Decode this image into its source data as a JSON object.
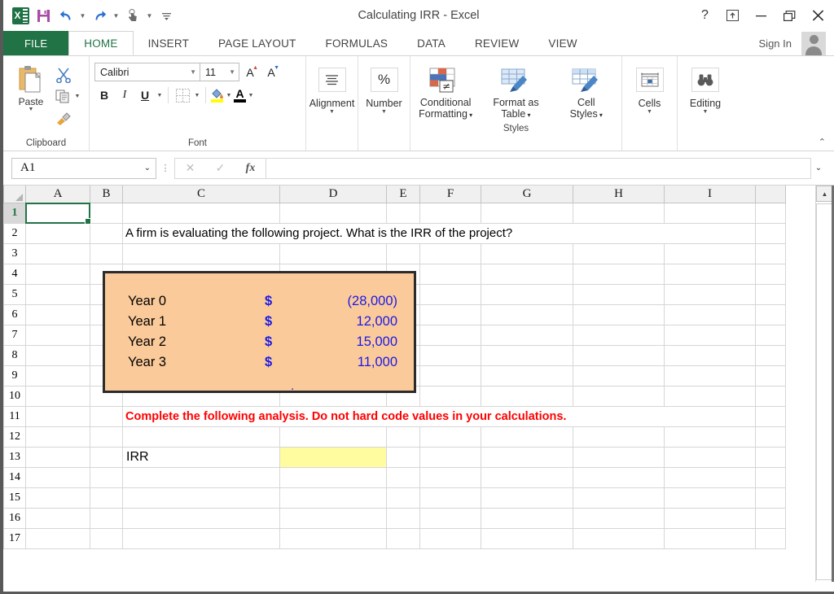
{
  "window": {
    "title": "Calculating IRR - Excel",
    "controls": {
      "help": "?",
      "ribbon_display": "ribbon-display-options",
      "minimize": "minimize",
      "restore": "restore",
      "close": "close"
    }
  },
  "quick_access": {
    "items": [
      {
        "name": "excel-logo",
        "label": "X"
      },
      {
        "name": "save-icon",
        "label": "Save"
      },
      {
        "name": "undo-icon",
        "label": "Undo"
      },
      {
        "name": "redo-icon",
        "label": "Redo"
      },
      {
        "name": "touch-mode-icon",
        "label": "Touch/Mouse Mode"
      },
      {
        "name": "customize-qat-icon",
        "label": "Customize Quick Access Toolbar"
      }
    ]
  },
  "tabs": [
    {
      "label": "FILE",
      "active": false
    },
    {
      "label": "HOME",
      "active": true
    },
    {
      "label": "INSERT",
      "active": false
    },
    {
      "label": "PAGE LAYOUT",
      "active": false
    },
    {
      "label": "FORMULAS",
      "active": false
    },
    {
      "label": "DATA",
      "active": false
    },
    {
      "label": "REVIEW",
      "active": false
    },
    {
      "label": "VIEW",
      "active": false
    }
  ],
  "account": {
    "sign_in": "Sign In"
  },
  "ribbon": {
    "groups": {
      "clipboard": {
        "label": "Clipboard",
        "paste": "Paste",
        "cut": "Cut",
        "copy": "Copy",
        "format_painter": "Format Painter"
      },
      "font": {
        "label": "Font",
        "font_name": "Calibri",
        "font_size": "11",
        "grow_font": "A",
        "shrink_font": "A",
        "bold": "B",
        "italic": "I",
        "underline": "U",
        "borders": "Borders",
        "fill_color": "Fill Color",
        "font_color": "A"
      },
      "alignment": {
        "label": "Alignment"
      },
      "number": {
        "label": "Number",
        "symbol": "%"
      },
      "styles": {
        "label": "Styles",
        "items": [
          {
            "line1": "Conditional",
            "line2": "Formatting"
          },
          {
            "line1": "Format as",
            "line2": "Table"
          },
          {
            "line1": "Cell",
            "line2": "Styles"
          }
        ]
      },
      "cells": {
        "label": "Cells"
      },
      "editing": {
        "label": "Editing"
      }
    },
    "collapse": "Collapse the Ribbon"
  },
  "formula_bar": {
    "name_box": "A1",
    "cancel": "cancel",
    "enter": "enter",
    "insert_function": "fx",
    "value": "",
    "expand": "expand-formula-bar"
  },
  "sheet": {
    "columns": [
      "A",
      "B",
      "C",
      "D",
      "E",
      "F",
      "G",
      "H",
      "I"
    ],
    "rows": [
      1,
      2,
      3,
      4,
      5,
      6,
      7,
      8,
      9,
      10,
      11,
      12,
      13,
      14,
      15,
      16,
      17
    ],
    "active_cell": "A1",
    "cells": {
      "C2": "A firm is evaluating the following project. What is the IRR of the project?",
      "C11": "Complete the following analysis. Do not hard code values in your calculations.",
      "C13": "IRR",
      "D13": ""
    },
    "cash_flow_table": {
      "rows": [
        {
          "label": "Year 0",
          "currency": "$",
          "amount": "(28,000)"
        },
        {
          "label": "Year 1",
          "currency": "$",
          "amount": "12,000"
        },
        {
          "label": "Year 2",
          "currency": "$",
          "amount": "15,000"
        },
        {
          "label": "Year 3",
          "currency": "$",
          "amount": "11,000"
        }
      ],
      "marker": "."
    }
  },
  "colors": {
    "excel_green": "#217346",
    "table_fill": "#fbca9a",
    "table_border": "#2b2b2b",
    "input_cell": "#fffca0",
    "value_blue": "#1a1ae6",
    "warning_red": "#ff0000"
  }
}
